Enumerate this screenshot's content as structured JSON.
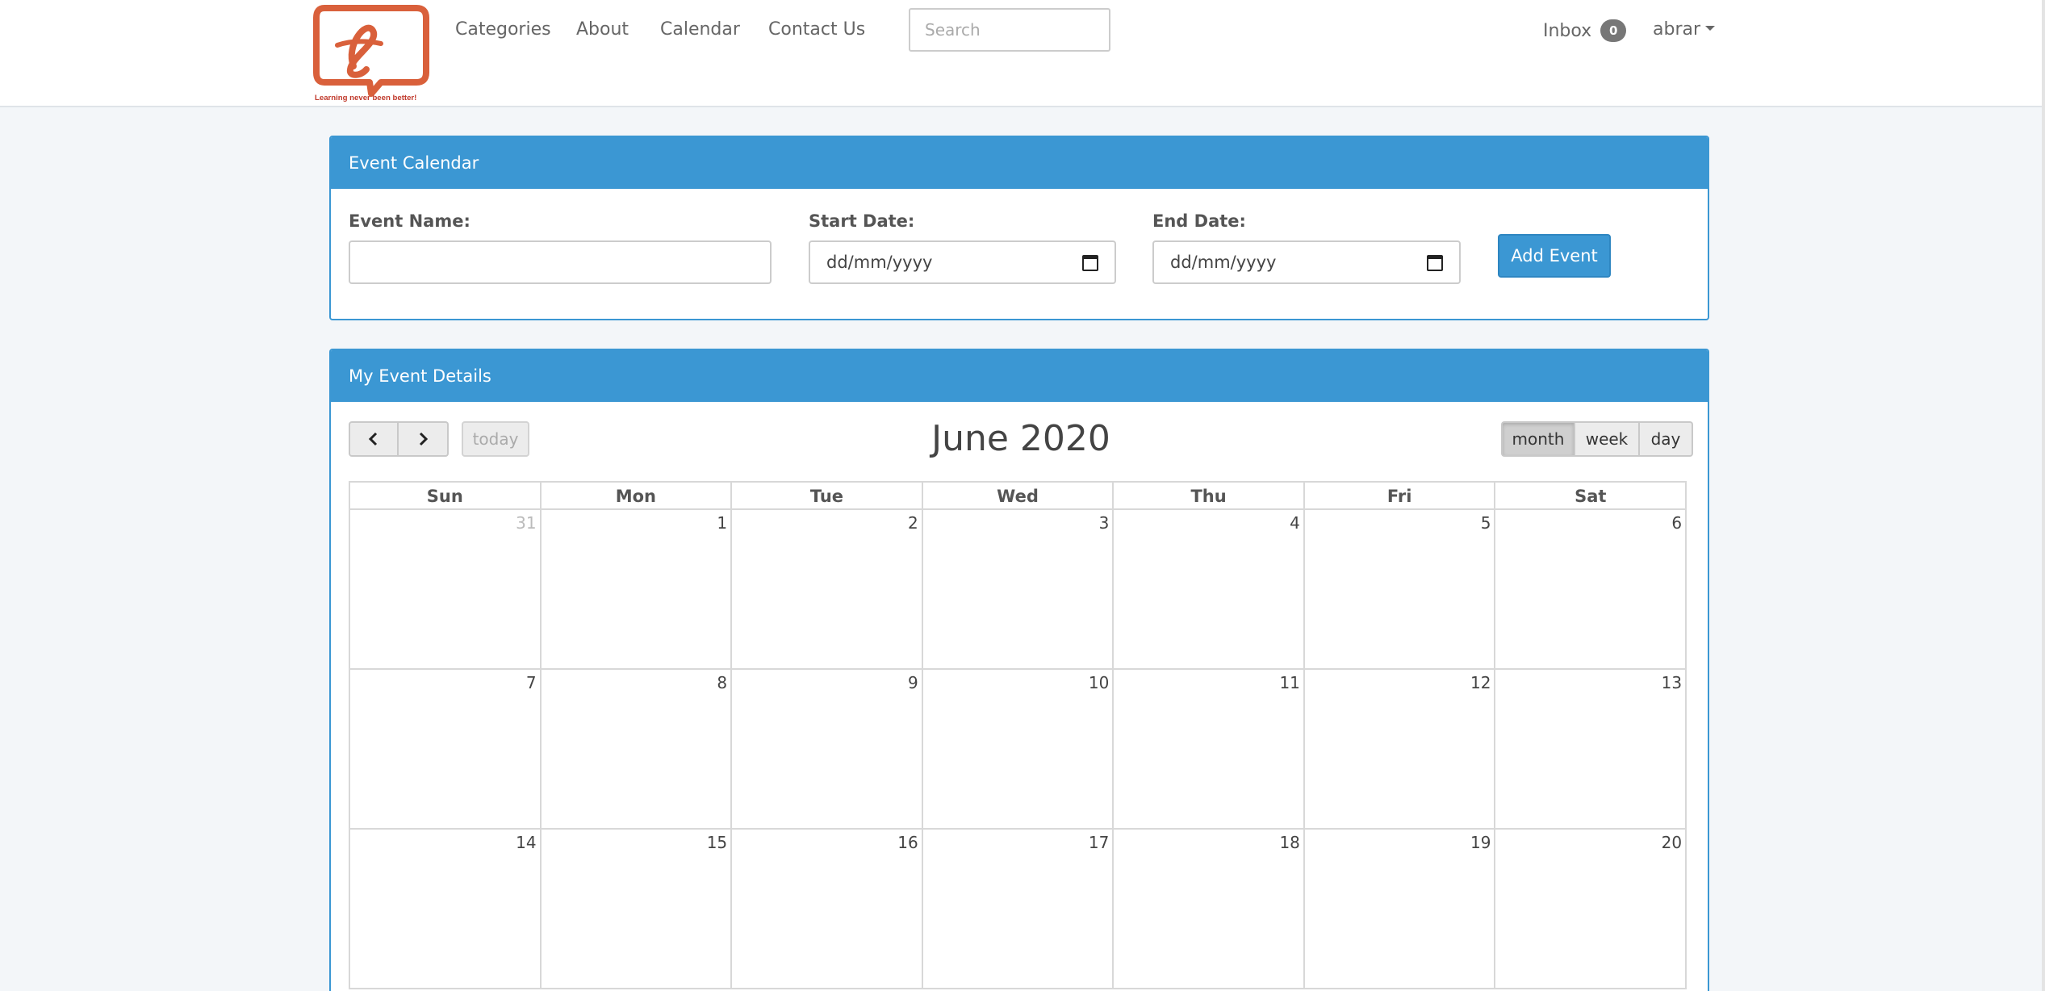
{
  "nav": {
    "logo_tagline": "Learning never been better!",
    "links": [
      "Categories",
      "About",
      "Calendar",
      "Contact Us"
    ],
    "search_placeholder": "Search",
    "inbox_label": "Inbox",
    "inbox_count": "0",
    "user_name": "abrar"
  },
  "event_form": {
    "heading": "Event Calendar",
    "event_name_label": "Event Name:",
    "event_name_value": "",
    "start_date_label": "Start Date:",
    "start_date_placeholder": "dd/mm/yyyy",
    "end_date_label": "End Date:",
    "end_date_placeholder": "dd/mm/yyyy",
    "add_button": "Add Event"
  },
  "calendar": {
    "heading": "My Event Details",
    "title": "June 2020",
    "today_button": "today",
    "views": [
      "month",
      "week",
      "day"
    ],
    "active_view": "month",
    "weekdays": [
      "Sun",
      "Mon",
      "Tue",
      "Wed",
      "Thu",
      "Fri",
      "Sat"
    ],
    "weeks": [
      [
        "31",
        "1",
        "2",
        "3",
        "4",
        "5",
        "6"
      ],
      [
        "7",
        "8",
        "9",
        "10",
        "11",
        "12",
        "13"
      ],
      [
        "14",
        "15",
        "16",
        "17",
        "18",
        "19",
        "20"
      ]
    ],
    "other_month_days": [
      "31"
    ]
  },
  "colors": {
    "primary": "#3b97d3",
    "logo": "#d9603b"
  }
}
